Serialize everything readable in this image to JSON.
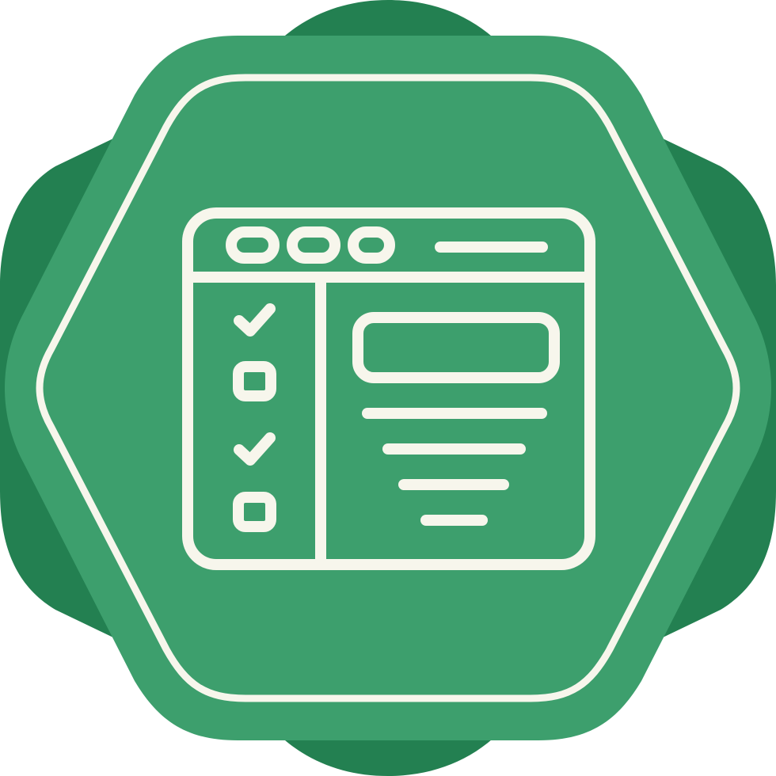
{
  "icon": {
    "name": "checklist-browser-window",
    "badge_shape": "hexagon-seal",
    "colors": {
      "background": "#ffffff",
      "badge_back": "#238051",
      "badge_front": "#3d9f6d",
      "line": "#f7f6ec"
    },
    "window": {
      "control_dots": 3,
      "has_title_bar_line": true
    },
    "checklist": {
      "items": [
        {
          "state": "checked"
        },
        {
          "state": "unchecked"
        },
        {
          "state": "checked"
        },
        {
          "state": "unchecked"
        }
      ]
    },
    "content_panel": {
      "header_box": true,
      "text_lines": 4
    }
  }
}
